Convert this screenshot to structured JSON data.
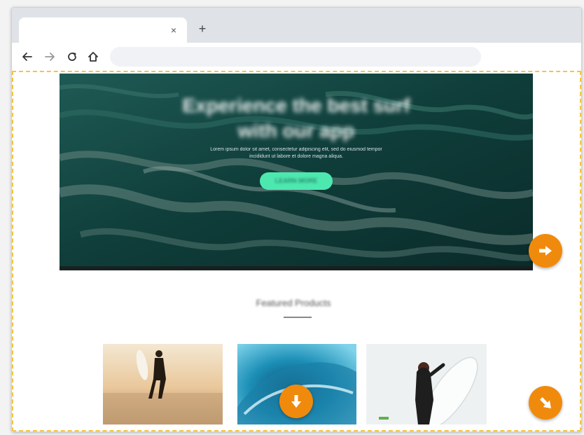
{
  "browser": {
    "tab": {
      "title": "",
      "close_glyph": "×"
    },
    "new_tab_glyph": "+",
    "nav": {
      "back_icon": "arrow-left-icon",
      "forward_icon": "arrow-right-icon",
      "reload_icon": "reload-icon",
      "home_icon": "home-icon"
    },
    "address": {
      "value": ""
    }
  },
  "hero": {
    "title_line1": "Experience the best surf",
    "title_line2": "with our app",
    "description": "Lorem ipsum dolor sit amet, consectetur adipiscing elit, sed do eiusmod tempor incididunt ut labore et dolore magna aliqua.",
    "cta_label": "LEARN MORE",
    "cta_color": "#4de8b0"
  },
  "featured": {
    "title": "Featured Products",
    "cards": [
      {
        "image": "surfer-on-beach-photo"
      },
      {
        "image": "ocean-wave-photo"
      },
      {
        "image": "woman-with-surfboard-photo"
      }
    ]
  },
  "hints": {
    "color": "#f08a0c",
    "items": [
      {
        "icon": "arrow-right-icon",
        "direction": "right"
      },
      {
        "icon": "arrow-down-icon",
        "direction": "down"
      },
      {
        "icon": "arrow-down-right-icon",
        "direction": "down-right"
      }
    ]
  },
  "selection_border_color": "#f5c542"
}
